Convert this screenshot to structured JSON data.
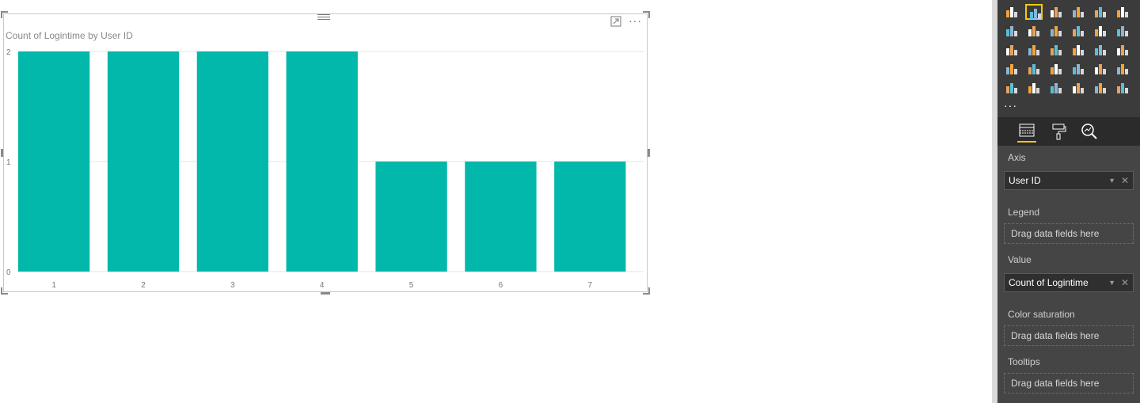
{
  "visual": {
    "title": "Count of Logintime by User ID",
    "more_label": "···"
  },
  "chart_data": {
    "type": "bar",
    "title": "Count of Logintime by User ID",
    "categories": [
      "1",
      "2",
      "3",
      "4",
      "5",
      "6",
      "7"
    ],
    "values": [
      2,
      2,
      2,
      2,
      1,
      1,
      1
    ],
    "y_ticks": [
      "0",
      "1",
      "2"
    ],
    "ylim": [
      0,
      2
    ],
    "grid": true,
    "bar_color": "#01B8AA"
  },
  "pane": {
    "more_label": "···",
    "viz_icons": [
      "stacked-bar-icon",
      "stacked-column-icon",
      "clustered-bar-icon",
      "clustered-column-icon",
      "100-stacked-bar-icon",
      "100-stacked-column-icon",
      "line-chart-icon",
      "area-chart-icon",
      "stacked-area-icon",
      "line-and-column-icon",
      "line-and-clustered-column-icon",
      "ribbon-chart-icon",
      "waterfall-icon",
      "scatter-icon",
      "pie-chart-icon",
      "donut-chart-icon",
      "treemap-icon",
      "map-icon",
      "filled-map-icon",
      "shape-map-icon",
      "funnel-icon",
      "gauge-icon",
      "card-icon",
      "multi-row-card-icon",
      "kpi-icon",
      "slicer-icon",
      "table-icon",
      "matrix-icon",
      "r-visual-icon",
      "globe-icon"
    ],
    "wells": {
      "axis": {
        "label": "Axis",
        "field": "User ID"
      },
      "legend": {
        "label": "Legend",
        "placeholder": "Drag data fields here"
      },
      "value": {
        "label": "Value",
        "field": "Count of Logintime"
      },
      "color_saturation": {
        "label": "Color saturation",
        "placeholder": "Drag data fields here"
      },
      "tooltips": {
        "label": "Tooltips",
        "placeholder": "Drag data fields here"
      }
    },
    "colors": {
      "accent": "#f2c811",
      "pane_bg": "#454545"
    }
  }
}
